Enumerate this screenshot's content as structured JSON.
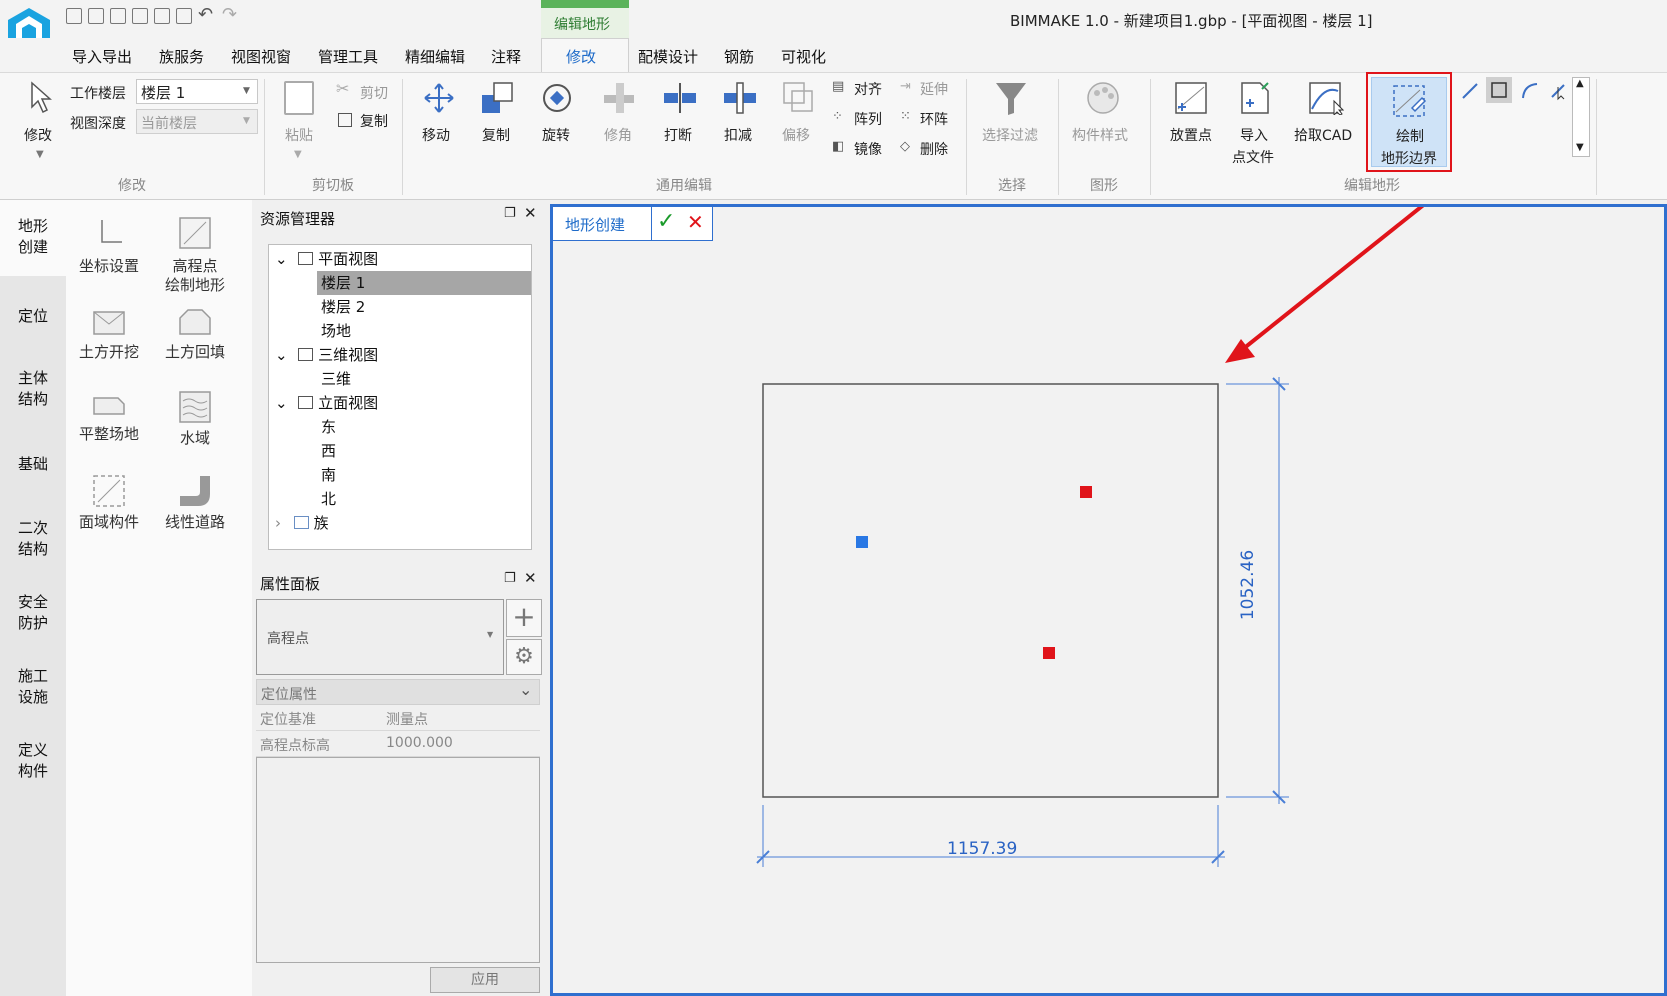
{
  "window_title": "BIMMAKE 1.0 - 新建项目1.gbp - [平面视图 - 楼层 1]",
  "context_tab": "编辑地形",
  "menu": [
    "导入导出",
    "族服务",
    "视图视窗",
    "管理工具",
    "精细编辑",
    "注释",
    "修改",
    "配模设计",
    "钢筋",
    "可视化"
  ],
  "ribbon": {
    "modify": {
      "label": "修改",
      "group": "修改",
      "work_floor_label": "工作楼层",
      "work_floor_value": "楼层 1",
      "view_depth_label": "视图深度",
      "view_depth_value": "当前楼层"
    },
    "clipboard": {
      "group": "剪切板",
      "paste": "粘贴",
      "cut": "剪切",
      "copy": "复制"
    },
    "general_edit": {
      "group": "通用编辑",
      "move": "移动",
      "copy": "复制",
      "rotate": "旋转",
      "trim": "修角",
      "break": "打断",
      "deduct": "扣减",
      "offset": "偏移",
      "align": "对齐",
      "extend": "延伸",
      "array": "阵列",
      "ring_array": "环阵",
      "mirror": "镜像",
      "delete": "删除"
    },
    "select": {
      "group": "选择",
      "filter": "选择过滤"
    },
    "graphics": {
      "group": "图形",
      "style": "构件样式"
    },
    "edit_terrain": {
      "group": "编辑地形",
      "place_point": "放置点",
      "import_point_file_1": "导入",
      "import_point_file_2": "点文件",
      "pick_cad": "拾取CAD",
      "draw_boundary_1": "绘制",
      "draw_boundary_2": "地形边界"
    }
  },
  "left_nav": [
    {
      "l1": "地形",
      "l2": "创建"
    },
    {
      "l1": "定位",
      "l2": ""
    },
    {
      "l1": "主体",
      "l2": "结构"
    },
    {
      "l1": "基础",
      "l2": ""
    },
    {
      "l1": "二次",
      "l2": "结构"
    },
    {
      "l1": "安全",
      "l2": "防护"
    },
    {
      "l1": "施工",
      "l2": "设施"
    },
    {
      "l1": "定义",
      "l2": "构件"
    }
  ],
  "tools": [
    {
      "l1": "坐标设置",
      "l2": ""
    },
    {
      "l1": "高程点",
      "l2": "绘制地形"
    },
    {
      "l1": "土方开挖",
      "l2": ""
    },
    {
      "l1": "土方回填",
      "l2": ""
    },
    {
      "l1": "平整场地",
      "l2": ""
    },
    {
      "l1": "水域",
      "l2": ""
    },
    {
      "l1": "面域构件",
      "l2": ""
    },
    {
      "l1": "线性道路",
      "l2": ""
    }
  ],
  "resource_manager": {
    "title": "资源管理器",
    "tree": [
      "平面视图",
      "楼层 1",
      "楼层 2",
      "场地",
      "三维视图",
      "三维",
      "立面视图",
      "东",
      "西",
      "南",
      "北",
      "族"
    ]
  },
  "properties": {
    "title": "属性面板",
    "type": "高程点",
    "section": "定位属性",
    "rows": [
      {
        "name": "定位基准",
        "value": "测量点"
      },
      {
        "name": "高程点标高",
        "value": "1000.000"
      }
    ],
    "apply": "应用"
  },
  "canvas": {
    "mode_label": "地形创建",
    "dim_width": "1157.39",
    "dim_height": "1052.46"
  },
  "colors": {
    "accent": "#2f6fcf",
    "highlight": "#e0141a",
    "dim": "#2f6fcf"
  }
}
